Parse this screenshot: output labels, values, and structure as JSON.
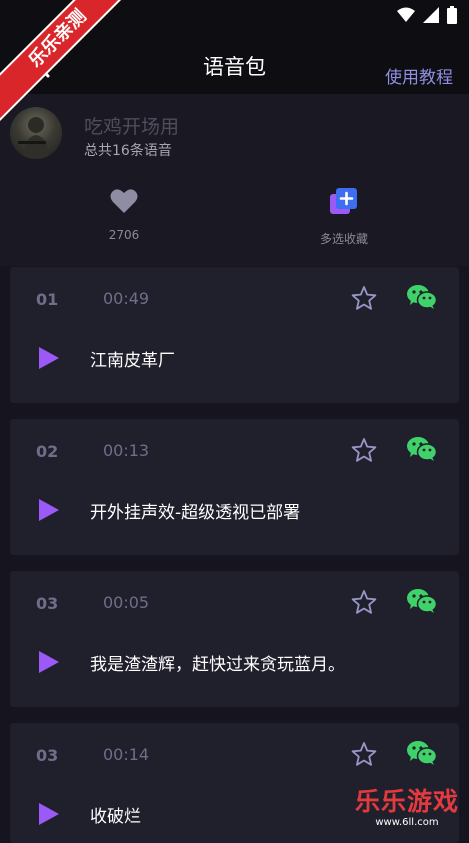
{
  "ribbon": "乐乐亲测",
  "header": {
    "title": "语音包",
    "tutorial_label": "使用教程"
  },
  "profile": {
    "name": "吃鸡开场用",
    "count_text": "总共16条语音"
  },
  "actions": [
    {
      "icon": "heart-icon",
      "label": "2706"
    },
    {
      "icon": "multi-collect-icon",
      "label": "多选收藏"
    }
  ],
  "tracks": [
    {
      "index": "01",
      "duration": "00:49",
      "name": "江南皮革厂"
    },
    {
      "index": "02",
      "duration": "00:13",
      "name": "开外挂声效-超级透视已部署"
    },
    {
      "index": "03",
      "duration": "00:05",
      "name": "我是渣渣辉，赶快过来贪玩蓝月。"
    },
    {
      "index": "03",
      "duration": "00:14",
      "name": "收破烂"
    }
  ],
  "watermark": {
    "title": "乐乐游戏",
    "url": "www.6ll.com"
  },
  "colors": {
    "accent": "#8f8ee0",
    "play": "#9b59f5",
    "wechat": "#3fd16a",
    "background": "#16151f"
  }
}
